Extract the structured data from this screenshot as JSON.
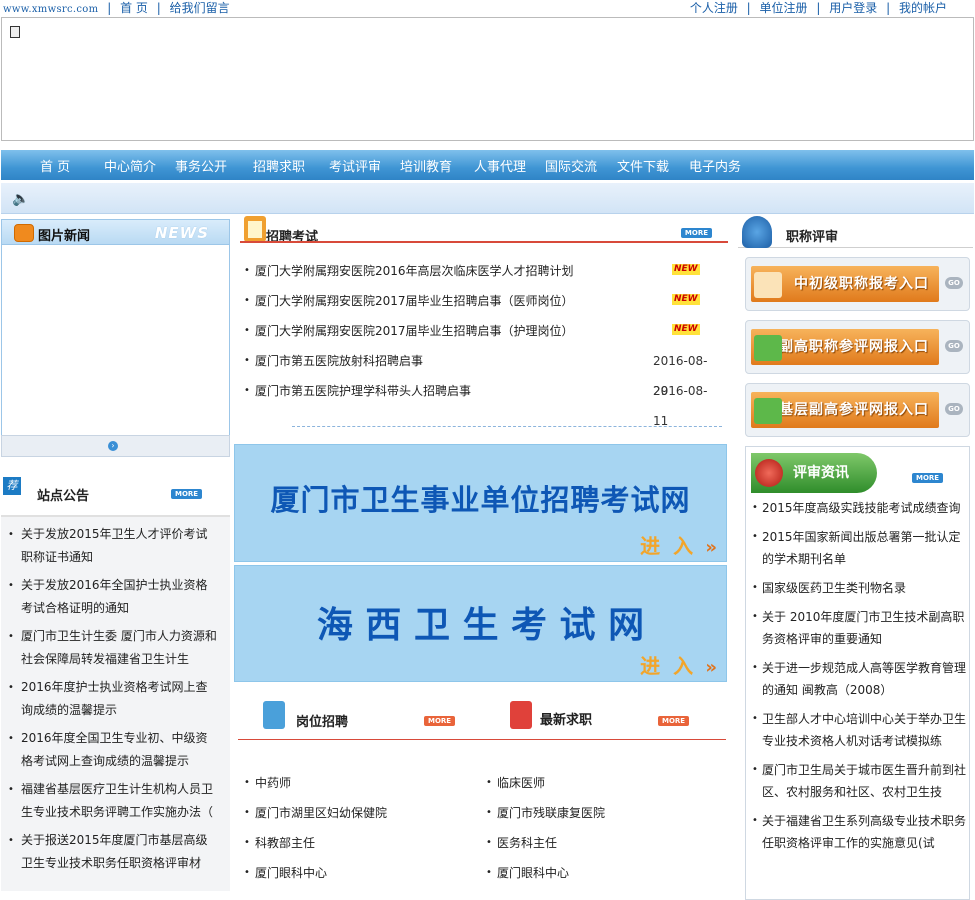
{
  "topbar": {
    "site": "www.xmwsrc.com",
    "home": "首 页",
    "guestbook": "给我们留言",
    "personal_register": "个人注册",
    "company_register": "单位注册",
    "login": "用户登录",
    "account": "我的帐户",
    "separator": "|"
  },
  "nav": {
    "items": [
      "首 页",
      "中心简介",
      "事务公开",
      "招聘求职",
      "考试评审",
      "培训教育",
      "人事代理",
      "国际交流",
      "文件下载",
      "电子内务"
    ]
  },
  "left": {
    "pic_news_title": "图片新闻",
    "pic_news_badge": "NEWS",
    "notice_badge": "荐",
    "notice_title": "站点公告",
    "more": "MORE",
    "notices": [
      "关于发放2015年卫生人才评价考试职称证书通知",
      "关于发放2016年全国护士执业资格考试合格证明的通知",
      "厦门市卫生计生委 厦门市人力资源和社会保障局转发福建省卫生计生",
      "2016年度护士执业资格考试网上查询成绩的温馨提示",
      "2016年度全国卫生专业初、中级资格考试网上查询成绩的温馨提示",
      "福建省基层医疗卫生计生机构人员卫生专业技术职务评聘工作实施办法（",
      "关于报送2015年度厦门市基层高级卫生专业技术职务任职资格评审材"
    ]
  },
  "middle": {
    "exam_title": "招聘考试",
    "more": "MORE",
    "new_badge": "NEW",
    "exam_items": [
      {
        "text": "厦门大学附属翔安医院2016年高层次临床医学人才招聘计划",
        "date": ""
      },
      {
        "text": "厦门大学附属翔安医院2017届毕业生招聘启事（医师岗位）",
        "date": ""
      },
      {
        "text": "厦门大学附属翔安医院2017届毕业生招聘启事（护理岗位）",
        "date": ""
      },
      {
        "text": "厦门市第五医院放射科招聘启事",
        "date": "2016-08-29"
      },
      {
        "text": "厦门市第五医院护理学科带头人招聘启事",
        "date": "2016-08-11"
      }
    ],
    "banner1": "厦门市卫生事业单位招聘考试网",
    "banner2": "海 西 卫 生 考 试 网",
    "banner_enter": "进 入",
    "jobs_title": "岗位招聘",
    "seek_title": "最新求职",
    "jobs": [
      "中药师",
      "厦门市湖里区妇幼保健院",
      "科教部主任",
      "厦门眼科中心"
    ],
    "seeks": [
      "临床医师",
      "厦门市残联康复医院",
      "医务科主任",
      "厦门眼科中心"
    ]
  },
  "right": {
    "title": "职称评审",
    "btn1": "中初级职称报考入口",
    "btn2": "副高职称参评网报入口",
    "btn3": "基层副高参评网报入口",
    "go": "GO",
    "review_title": "评审资讯",
    "more": "MORE",
    "items": [
      "2015年度高级实践技能考试成绩查询",
      "2015年国家新闻出版总署第一批认定的学术期刊名单",
      "国家级医药卫生类刊物名录",
      "关于 2010年度厦门市卫生技术副高职务资格评审的重要通知",
      "关于进一步规范成人高等医学教育管理的通知 闽教高（2008）",
      "卫生部人才中心培训中心关于举办卫生专业技术资格人机对话考试模拟练",
      "厦门市卫生局关于城市医生晋升前到社区、农村服务和社区、农村卫生技",
      "关于福建省卫生系列高级专业技术职务任职资格评审工作的实施意见(试"
    ]
  },
  "colors": {
    "accent_blue": "#3f95d4",
    "link_blue": "#1a5fa8",
    "line_red": "#d84a3a",
    "button_orange": "#e07a1c",
    "banner_blue": "#a7d5f2"
  }
}
